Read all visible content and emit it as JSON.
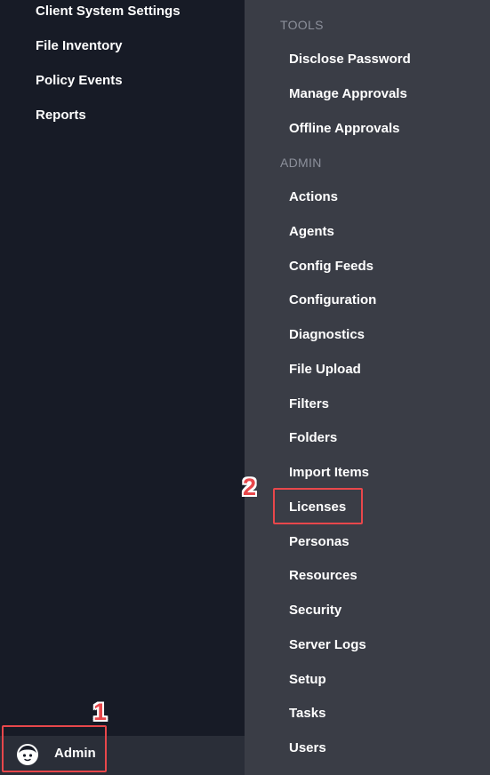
{
  "left_menu": {
    "items": [
      {
        "label": "Client System Settings"
      },
      {
        "label": "File Inventory"
      },
      {
        "label": "Policy Events"
      },
      {
        "label": "Reports"
      }
    ]
  },
  "right_menu": {
    "tools_header": "TOOLS",
    "tools": [
      {
        "label": "Disclose Password"
      },
      {
        "label": "Manage Approvals"
      },
      {
        "label": "Offline Approvals"
      }
    ],
    "admin_header": "ADMIN",
    "admin": [
      {
        "label": "Actions"
      },
      {
        "label": "Agents"
      },
      {
        "label": "Config Feeds"
      },
      {
        "label": "Configuration"
      },
      {
        "label": "Diagnostics"
      },
      {
        "label": "File Upload"
      },
      {
        "label": "Filters"
      },
      {
        "label": "Folders"
      },
      {
        "label": "Import Items"
      },
      {
        "label": "Licenses"
      },
      {
        "label": "Personas"
      },
      {
        "label": "Resources"
      },
      {
        "label": "Security"
      },
      {
        "label": "Server Logs"
      },
      {
        "label": "Setup"
      },
      {
        "label": "Tasks"
      },
      {
        "label": "Users"
      }
    ]
  },
  "user": {
    "label": "Admin",
    "icon": "user-avatar-icon"
  },
  "annotations": {
    "step1": "1",
    "step2": "2",
    "color": "#e8474b"
  }
}
